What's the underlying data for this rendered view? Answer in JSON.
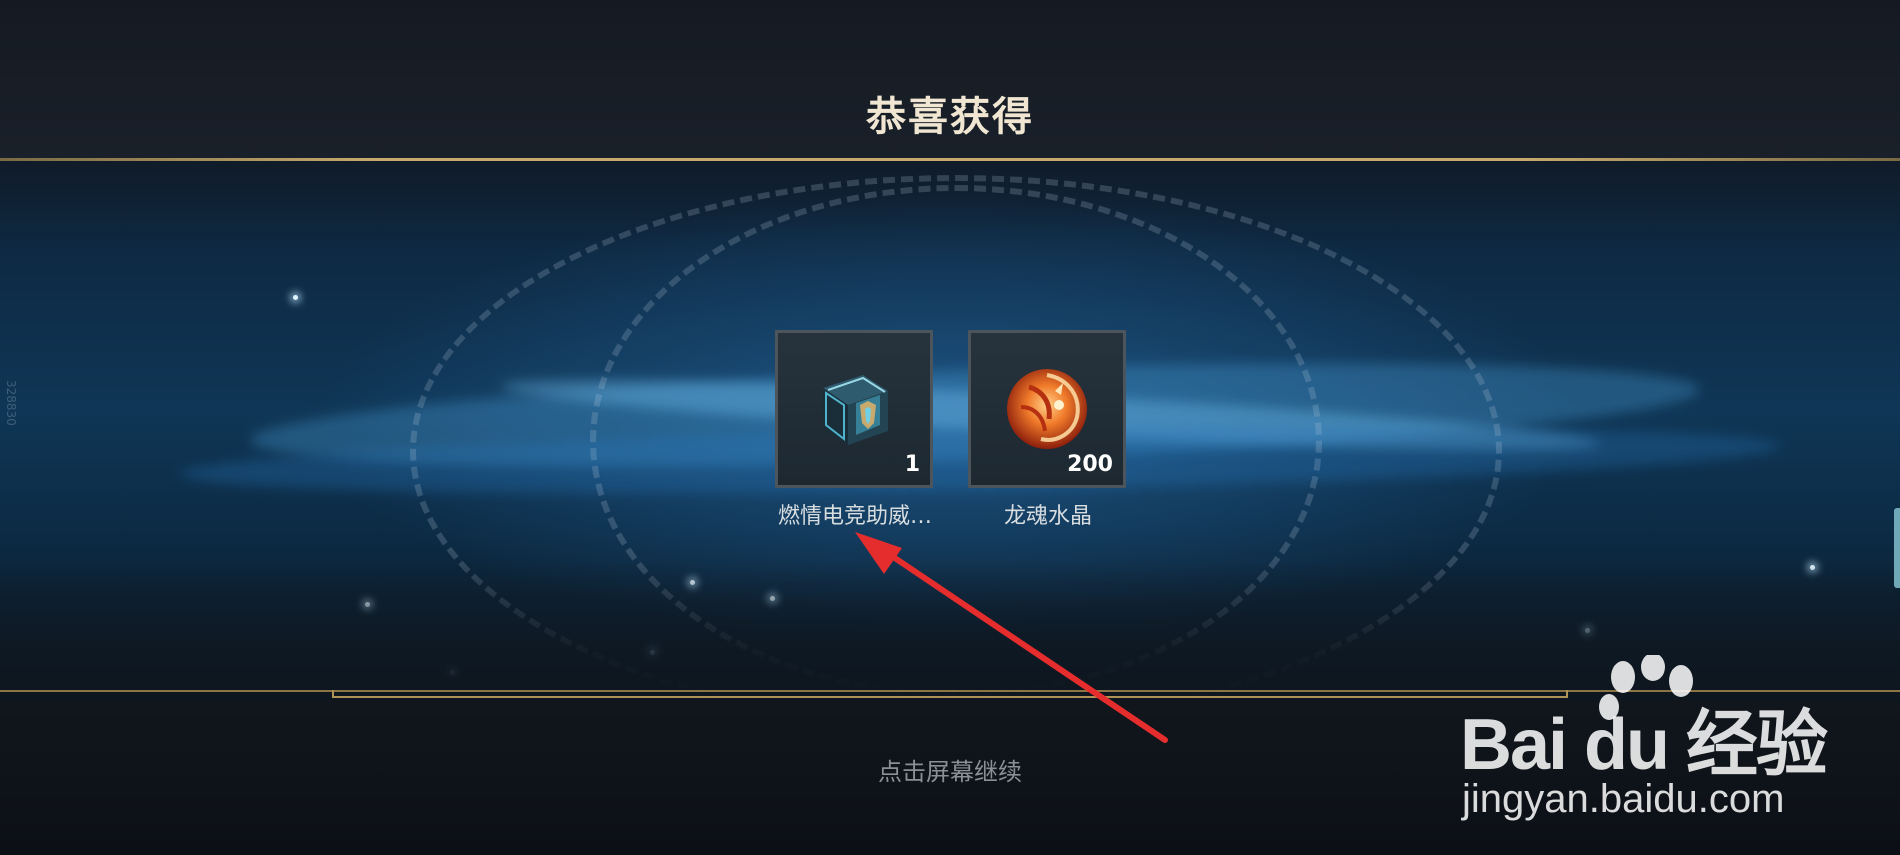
{
  "header": {
    "title": "恭喜获得"
  },
  "rewards": [
    {
      "name": "燃情电竞助威…",
      "quantity": "1",
      "icon": "hextech-chest-icon"
    },
    {
      "name": "龙魂水晶",
      "quantity": "200",
      "icon": "dragon-crystal-icon"
    }
  ],
  "footer": {
    "continue_text": "点击屏幕继续"
  },
  "side_tag": "328830",
  "watermark": {
    "brand": "Bai du 经验",
    "url": "jingyan.baidu.com"
  },
  "colors": {
    "gold": "#c8aa6e",
    "title": "#f0e6d2",
    "annotation_arrow": "#e62d2d"
  }
}
